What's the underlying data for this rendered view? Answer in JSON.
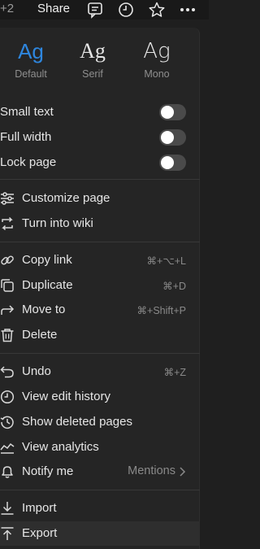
{
  "topbar": {
    "collaborators": "+2",
    "share_label": "Share"
  },
  "fonts": [
    {
      "sample": "Ag",
      "label": "Default",
      "color": "#2e86de"
    },
    {
      "sample": "Ag",
      "label": "Serif",
      "color": "#e6e6e6"
    },
    {
      "sample": "Ag",
      "label": "Mono",
      "color": "#e6e6e6"
    }
  ],
  "toggles": [
    {
      "label": "Small text",
      "on": false
    },
    {
      "label": "Full width",
      "on": false
    },
    {
      "label": "Lock page",
      "on": false
    }
  ],
  "menu": {
    "customize": "Customize page",
    "wiki": "Turn into wiki",
    "copy_link": "Copy link",
    "copy_link_shortcut": "⌘+⌥+L",
    "duplicate": "Duplicate",
    "duplicate_shortcut": "⌘+D",
    "move_to": "Move to",
    "move_to_shortcut": "⌘+Shift+P",
    "delete": "Delete",
    "undo": "Undo",
    "undo_shortcut": "⌘+Z",
    "history": "View edit history",
    "deleted": "Show deleted pages",
    "analytics": "View analytics",
    "notify": "Notify me",
    "notify_value": "Mentions",
    "import": "Import",
    "export": "Export"
  },
  "icons": [
    "comment-icon",
    "clock-icon",
    "star-icon",
    "more-icon",
    "sliders-icon",
    "wiki-icon",
    "link-icon",
    "duplicate-icon",
    "move-arrow-icon",
    "trash-icon",
    "undo-icon",
    "history-icon",
    "deleted-pages-icon",
    "analytics-icon",
    "bell-icon",
    "import-icon",
    "export-icon",
    "chevron-right-icon"
  ],
  "colors": {
    "accent": "#2e86de",
    "panel": "#252525"
  }
}
